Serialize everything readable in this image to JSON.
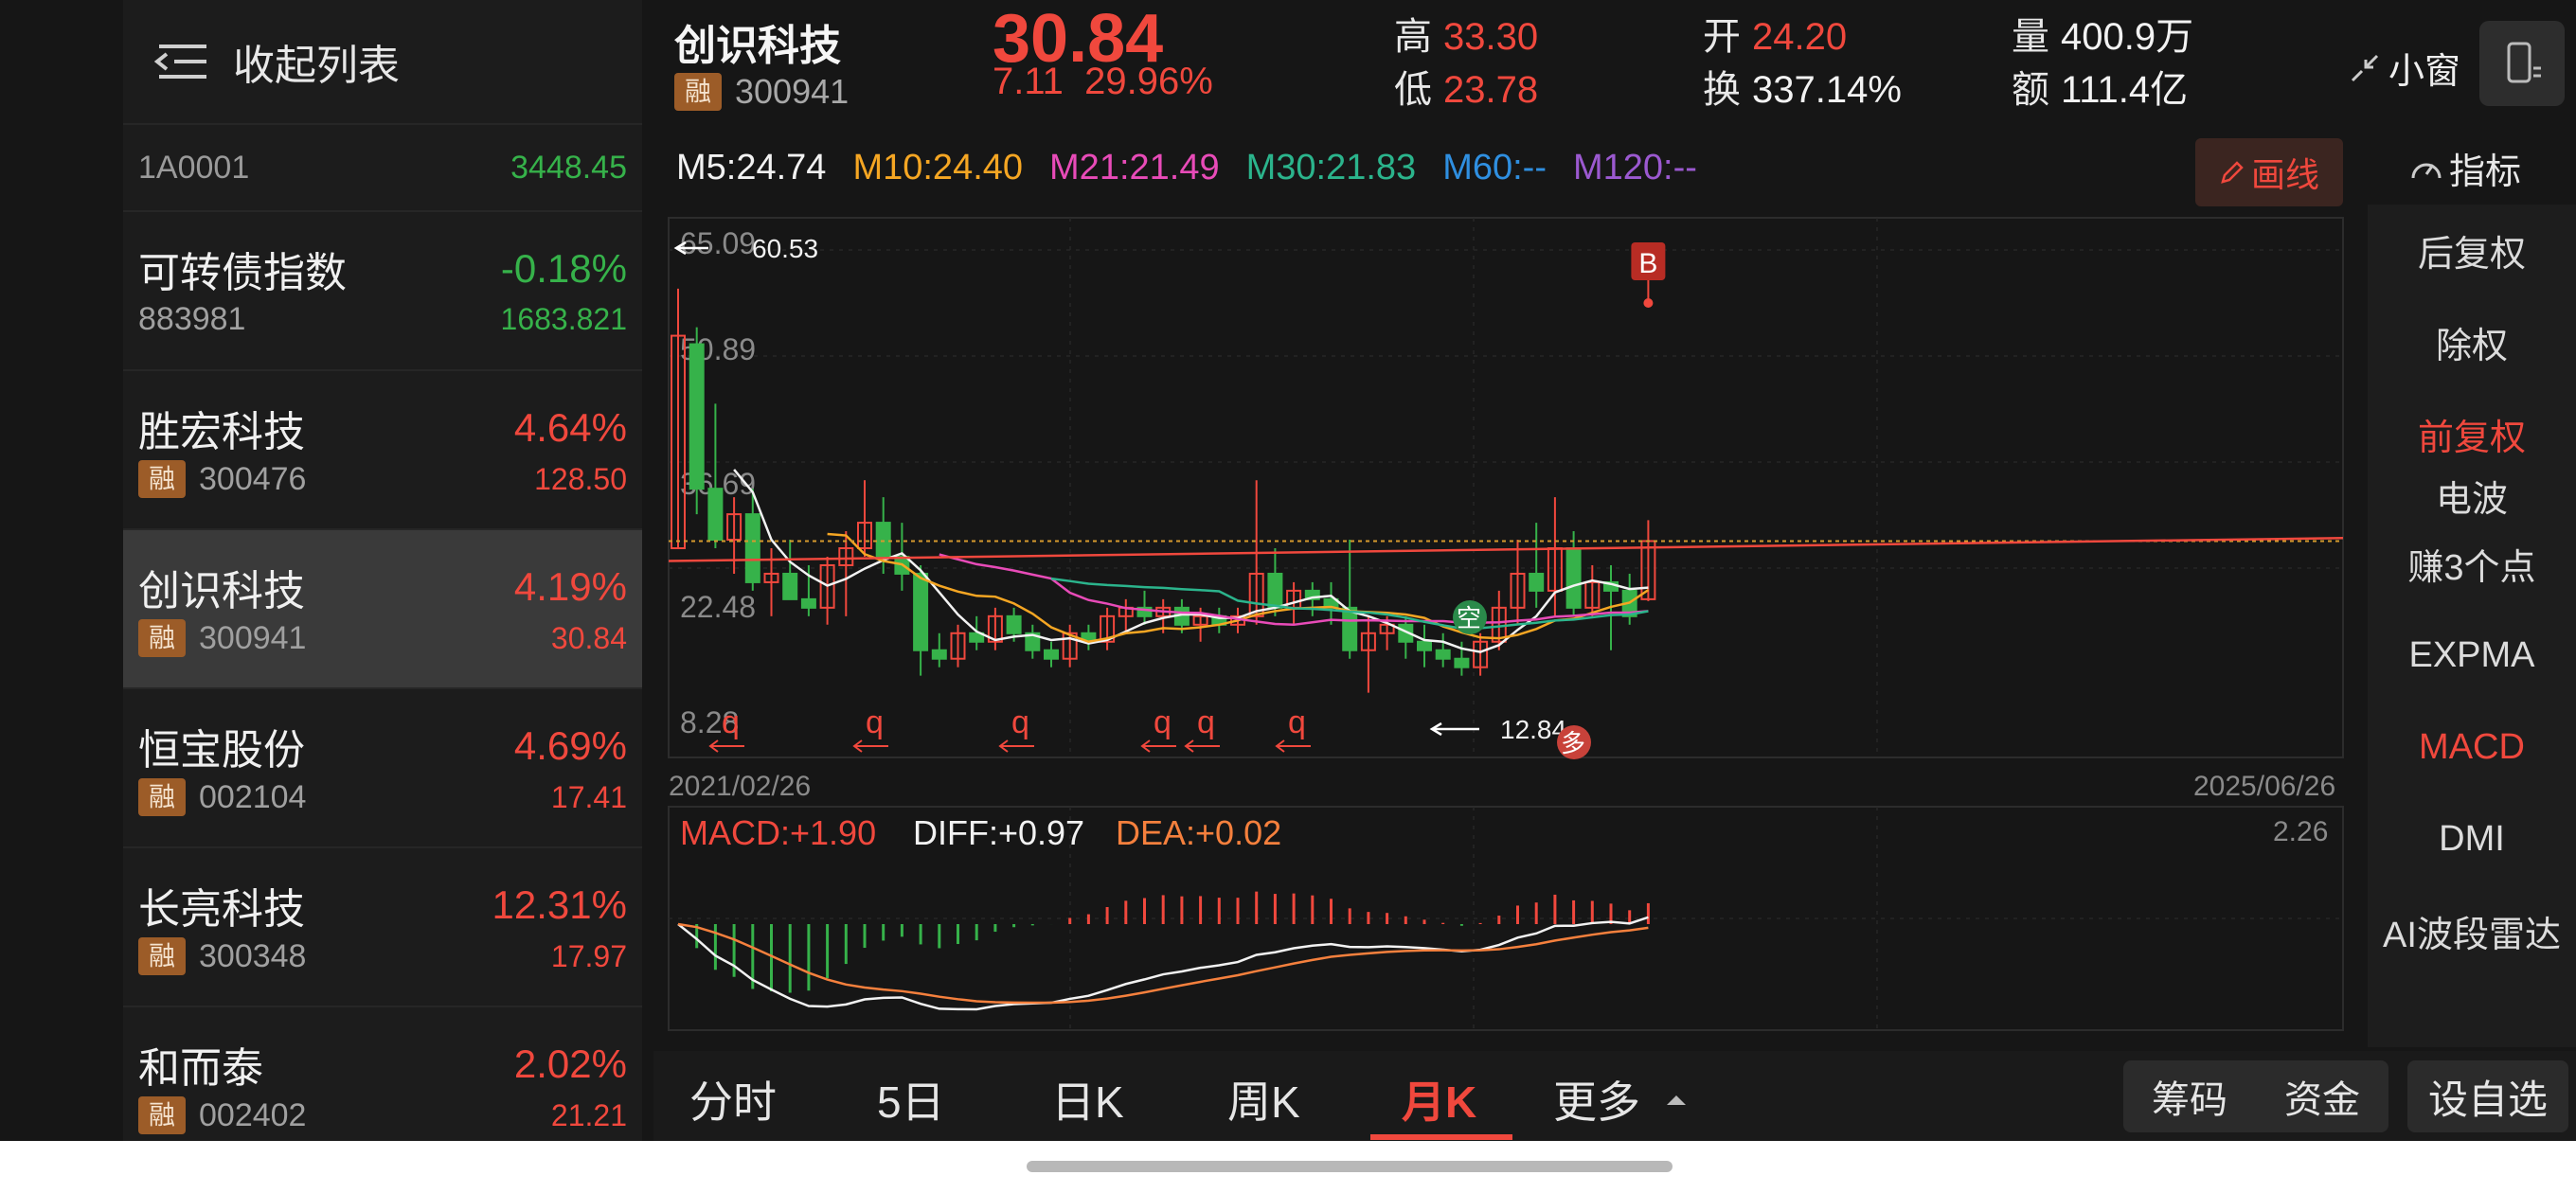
{
  "sidebar": {
    "collapse_label": "收起列表",
    "index_row": {
      "code": "1A0001",
      "value": "3448.45"
    },
    "items": [
      {
        "name": "可转债指数",
        "code": "883981",
        "pct": "-0.18%",
        "price": "1683.821",
        "rong": false,
        "color": "green"
      },
      {
        "name": "胜宏科技",
        "code": "300476",
        "pct": "4.64%",
        "price": "128.50",
        "rong": true,
        "color": "red"
      },
      {
        "name": "创识科技",
        "code": "300941",
        "pct": "4.19%",
        "price": "30.84",
        "rong": true,
        "color": "red",
        "active": true
      },
      {
        "name": "恒宝股份",
        "code": "002104",
        "pct": "4.69%",
        "price": "17.41",
        "rong": true,
        "color": "red"
      },
      {
        "name": "长亮科技",
        "code": "300348",
        "pct": "12.31%",
        "price": "17.97",
        "rong": true,
        "color": "red"
      },
      {
        "name": "和而泰",
        "code": "002402",
        "pct": "2.02%",
        "price": "21.21",
        "rong": true,
        "color": "red"
      }
    ],
    "rong_label": "融"
  },
  "header": {
    "name": "创识科技",
    "code": "300941",
    "price": "30.84",
    "change": "7.11",
    "change_pct": "29.96%",
    "high_label": "高",
    "high": "33.30",
    "low_label": "低",
    "low": "23.78",
    "open_label": "开",
    "open": "24.20",
    "turnover_label": "换",
    "turnover": "337.14%",
    "volume_label": "量",
    "volume": "400.9万",
    "amount_label": "额",
    "amount": "111.4亿",
    "mini_window": "小窗"
  },
  "ma": {
    "m5": "M5:24.74",
    "m10": "M10:24.40",
    "m21": "M21:21.49",
    "m30": "M30:21.83",
    "m60": "M60:--",
    "m120": "M120:--"
  },
  "colors": {
    "m5": "#f2f2f2",
    "m10": "#f5a623",
    "m21": "#e84bb8",
    "m30": "#2bb48c",
    "m60": "#2f8fe0",
    "m120": "#9b59d0",
    "up": "#f0483d",
    "down": "#36b24a"
  },
  "draw_label": "画线",
  "indicator_label": "指标",
  "chart_data": {
    "type": "candlestick",
    "start_date": "2021/02/26",
    "end_date": "2025/06/26",
    "y_ticks": [
      "65.09",
      "50.89",
      "36.69",
      "22.48",
      "8.28"
    ],
    "max_label": "60.53",
    "min_label": "12.84",
    "buy_marker": "B",
    "kong_marker": "空",
    "duo_marker": "多",
    "q_marker": "q",
    "candles": [
      [
        30,
        60.53,
        30,
        55
      ],
      [
        54,
        56,
        34,
        37
      ],
      [
        37,
        47,
        30,
        31
      ],
      [
        31,
        36,
        27,
        34
      ],
      [
        34,
        37,
        25,
        26
      ],
      [
        26,
        30,
        22,
        27
      ],
      [
        27,
        31,
        24,
        24
      ],
      [
        24,
        28,
        22,
        23
      ],
      [
        23,
        29,
        21,
        28
      ],
      [
        28,
        32,
        22,
        30
      ],
      [
        30,
        38,
        29,
        33
      ],
      [
        33,
        36,
        27,
        29
      ],
      [
        29,
        33,
        25,
        27
      ],
      [
        27,
        28,
        15,
        18
      ],
      [
        18,
        20,
        16,
        17
      ],
      [
        17,
        21,
        16,
        20
      ],
      [
        20,
        22,
        18,
        19
      ],
      [
        19,
        23,
        18,
        22
      ],
      [
        22,
        23,
        19,
        20
      ],
      [
        20,
        21,
        17,
        18
      ],
      [
        18,
        19,
        16,
        17
      ],
      [
        17,
        21,
        16,
        20
      ],
      [
        20,
        21,
        18,
        19
      ],
      [
        19,
        23,
        18,
        22
      ],
      [
        22,
        24,
        20,
        23
      ],
      [
        23,
        25,
        21,
        22
      ],
      [
        22,
        24,
        20,
        23
      ],
      [
        23,
        24,
        20,
        21
      ],
      [
        21,
        23,
        19,
        22
      ],
      [
        22,
        23,
        20,
        21
      ],
      [
        21,
        23,
        20,
        22
      ],
      [
        22,
        38,
        21,
        27
      ],
      [
        27,
        30,
        22,
        23
      ],
      [
        23,
        26,
        21,
        25
      ],
      [
        25,
        26,
        22,
        24
      ],
      [
        24,
        26,
        21,
        23
      ],
      [
        23,
        31,
        17,
        18
      ],
      [
        18,
        22,
        13,
        20
      ],
      [
        20,
        22,
        18,
        21
      ],
      [
        21,
        22,
        17,
        19
      ],
      [
        19,
        21,
        16,
        18
      ],
      [
        18,
        20,
        16,
        17
      ],
      [
        17,
        19,
        15,
        16
      ],
      [
        16,
        20,
        15,
        19
      ],
      [
        19,
        25,
        18,
        23
      ],
      [
        23,
        31,
        21,
        27
      ],
      [
        27,
        33,
        23,
        25
      ],
      [
        25,
        36,
        22,
        30
      ],
      [
        30,
        32,
        22,
        23
      ],
      [
        23,
        28,
        22,
        26
      ],
      [
        26,
        28,
        18,
        25
      ],
      [
        25,
        27,
        21,
        22
      ],
      [
        24,
        33.3,
        23.78,
        30.84
      ]
    ]
  },
  "macd": {
    "macd_label": "MACD:+1.90",
    "diff_label": "DIFF:+0.97",
    "dea_label": "DEA:+0.02",
    "top_value": "2.26"
  },
  "right_panel": {
    "items": [
      "后复权",
      "除权",
      "前复权",
      "赚3个点",
      "EXPMA",
      "MACD",
      "DMI",
      "AI波段雷达"
    ],
    "clipped": "电波",
    "active": [
      "前复权",
      "MACD"
    ]
  },
  "bottom_tabs": {
    "tabs": [
      "分时",
      "5日",
      "日K",
      "周K",
      "月K",
      "更多"
    ],
    "active": "月K",
    "chips_label": "筹码",
    "funds_label": "资金",
    "fav_label": "设自选"
  }
}
